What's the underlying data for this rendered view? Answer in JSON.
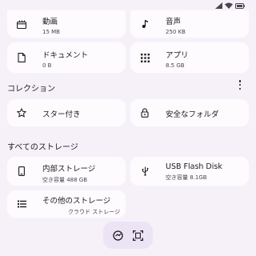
{
  "categories": {
    "video": {
      "label": "動画",
      "size": "15 MB",
      "icon": "clapperboard-icon"
    },
    "audio": {
      "label": "音声",
      "size": "250 KB",
      "icon": "music-note-icon"
    },
    "documents": {
      "label": "ドキュメント",
      "size": "0 B",
      "icon": "document-icon"
    },
    "apps": {
      "label": "アプリ",
      "size": "8.5 GB",
      "icon": "apps-grid-icon"
    }
  },
  "collections": {
    "heading": "コレクション",
    "starred": {
      "label": "スター付き",
      "icon": "star-icon"
    },
    "safe_folder": {
      "label": "安全なフォルダ",
      "icon": "lock-icon"
    }
  },
  "storage": {
    "heading": "すべてのストレージ",
    "internal": {
      "label": "内部ストレージ",
      "free": "空き容量 488 GB",
      "icon": "phone-icon"
    },
    "usb": {
      "label": "USB Flash Disk",
      "free": "空き容量 8.1GB",
      "icon": "usb-icon"
    },
    "other": {
      "label": "その他のストレージ",
      "desc": "クラウド ストレージ",
      "icon": "list-icon"
    }
  },
  "colors": {
    "background": "#f6f1f9",
    "card": "#fefbff",
    "fab_bar": "#ece3f5"
  }
}
